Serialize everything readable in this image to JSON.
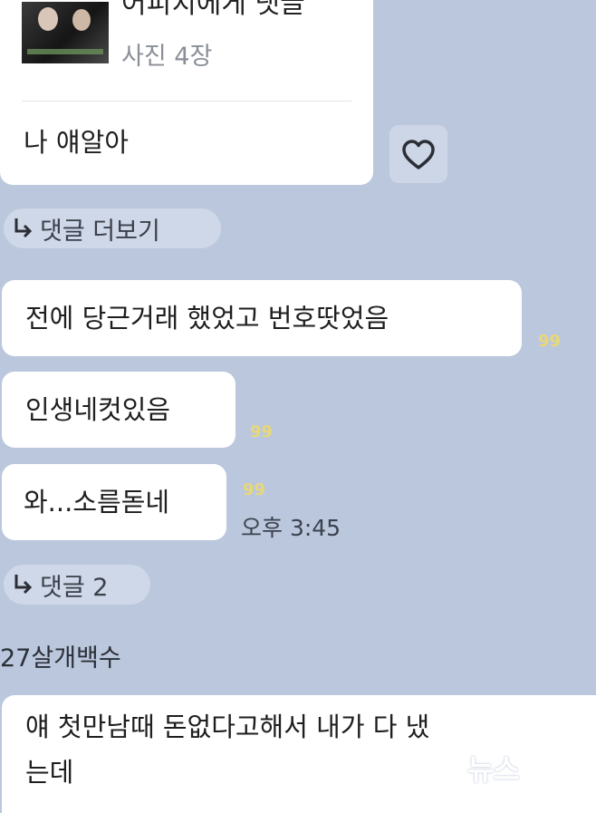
{
  "top_card": {
    "title": "어피치에게 댓글",
    "photo_count": "사진 4장",
    "message": "나 얘알아"
  },
  "reply_chips": {
    "more_label": "댓글 더보기",
    "count_label": "댓글 2"
  },
  "messages": [
    {
      "text": "전에 당근거래 했었고 번호땃었음",
      "unread": "99"
    },
    {
      "text": "인생네컷있음",
      "unread": "99"
    },
    {
      "text": "와...소름돋네",
      "unread": "99",
      "time": "오후 3:45"
    }
  ],
  "sender": {
    "name": "27살개백수",
    "message_line1": "얘 첫만남때 돈없다고해서 내가 다 냈",
    "message_line2": "는데"
  },
  "watermark": {
    "text": "뉴스",
    "mark": "1"
  }
}
